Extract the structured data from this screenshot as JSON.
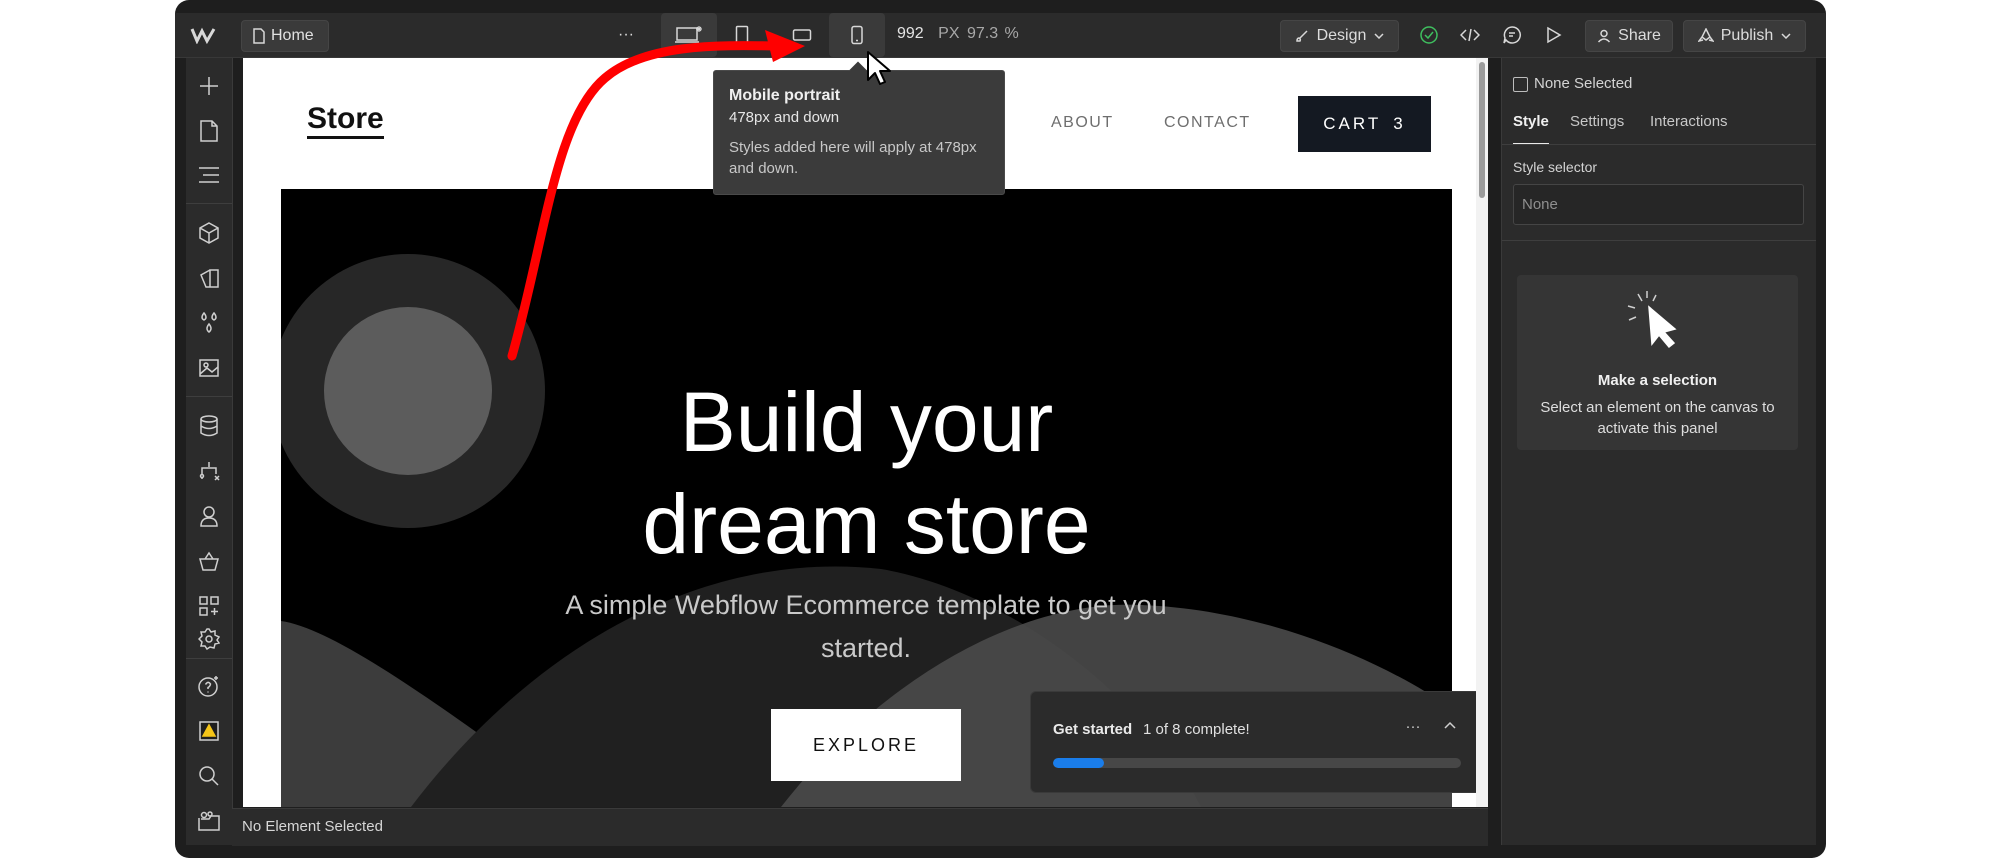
{
  "topbar": {
    "page_name": "Home",
    "more_label": "···",
    "breakpoint_width": "992",
    "px_label": "PX",
    "zoom": "97.3",
    "zoom_unit": "%",
    "mode_label": "Design",
    "share_label": "Share",
    "publish_label": "Publish"
  },
  "tooltip": {
    "title": "Mobile portrait",
    "subtitle": "478px and down",
    "body": "Styles added here will apply at 478px and down."
  },
  "site": {
    "logo": "Store",
    "nav": [
      "ABOUT",
      "CONTACT"
    ],
    "cart_label": "CART",
    "cart_count": "3",
    "hero_line1": "Build your",
    "hero_line2": "dream store",
    "hero_sub": "A simple Webflow Ecommerce template to get you started.",
    "cta": "EXPLORE"
  },
  "get_started": {
    "title": "Get started",
    "progress_text": "1 of 8 complete!",
    "progress": 0.125
  },
  "status": {
    "text": "No Element Selected"
  },
  "right_panel": {
    "none_selected": "None Selected",
    "tabs": [
      "Style",
      "Settings",
      "Interactions"
    ],
    "active_tab": "Style",
    "style_selector_label": "Style selector",
    "style_selector_placeholder": "None",
    "empty_title": "Make a selection",
    "empty_body": "Select an element on the canvas to activate this panel"
  },
  "colors": {
    "accent_blue": "#1a7dea",
    "annotation_arrow": "#ff0000",
    "success_green": "#3fbf5f",
    "warning_yellow": "#f5c518"
  },
  "icons": {
    "left_toolbar": [
      "add-icon",
      "pages-icon",
      "navigator-icon",
      "components-icon",
      "style-manager-icon",
      "variables-icon",
      "assets-icon",
      "cms-icon",
      "logic-icon",
      "users-icon",
      "ecommerce-icon",
      "apps-icon",
      "settings-icon",
      "help-icon",
      "audit-warning-icon",
      "search-icon",
      "video-icon"
    ]
  }
}
